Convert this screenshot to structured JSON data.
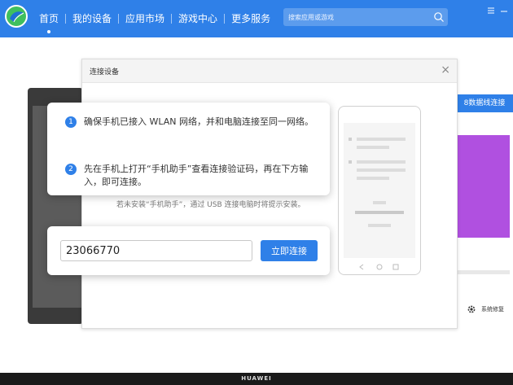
{
  "app": {
    "nav": {
      "items": [
        {
          "label": "首页"
        },
        {
          "label": "我的设备"
        },
        {
          "label": "应用市场"
        },
        {
          "label": "游戏中心"
        },
        {
          "label": "更多服务"
        }
      ],
      "active_index": 0
    },
    "search": {
      "placeholder": "搜索应用或游戏",
      "icon": "search-icon"
    },
    "window_controls": {
      "menu_icon": "menu-icon",
      "minimize_icon": "minimize-icon"
    }
  },
  "background": {
    "right_button_label": "8数据线连接",
    "repair_label": "系统修复",
    "repair_icon": "gear-icon"
  },
  "dialog": {
    "title": "连接设备",
    "close_icon": "close-icon",
    "steps": [
      {
        "number": "1",
        "text": "确保手机已接入 WLAN 网络，并和电脑连接至同一网络。"
      },
      {
        "number": "2",
        "text": "先在手机上打开“手机助手”查看连接验证码，再在下方输入，即可连接。"
      }
    ],
    "install_note": "若未安装“手机助手”，通过 USB 连接电脑时将提示安装。",
    "code_input_value": "23066770",
    "connect_button_label": "立即连接"
  },
  "footer": {
    "brand": "HUAWEI"
  },
  "colors": {
    "accent": "#2f80e8",
    "purple_card": "#b050e0",
    "device_body": "#3a3a3a"
  }
}
